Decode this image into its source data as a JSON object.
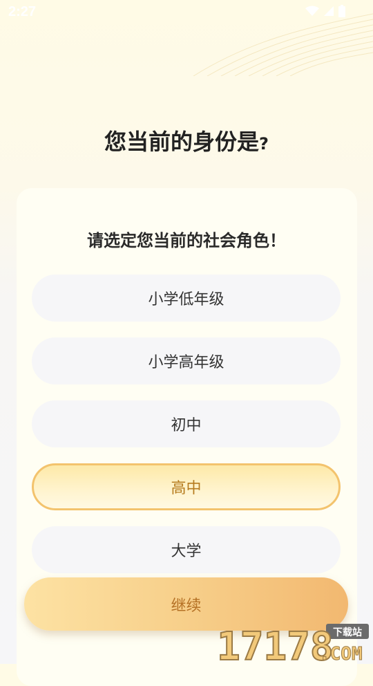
{
  "status_bar": {
    "time": "2:27"
  },
  "header": {
    "title": "您当前的身份是",
    "title_mark": "?"
  },
  "card": {
    "subtitle": "请选定您当前的社会角色！",
    "options": [
      {
        "label": "小学低年级",
        "selected": false
      },
      {
        "label": "小学高年级",
        "selected": false
      },
      {
        "label": "初中",
        "selected": false
      },
      {
        "label": "高中",
        "selected": true
      },
      {
        "label": "大学",
        "selected": false
      }
    ]
  },
  "actions": {
    "continue_label": "继续"
  },
  "watermark": {
    "numbers": "17178",
    "tag": "下载站",
    "suffix": ".COM"
  },
  "colors": {
    "accent": "#f3c36d",
    "selected_text": "#b57b1e",
    "continue_text": "#b57125",
    "option_bg": "#f6f6f8"
  },
  "icons": [
    "wifi-icon",
    "signal-icon",
    "battery-icon"
  ]
}
